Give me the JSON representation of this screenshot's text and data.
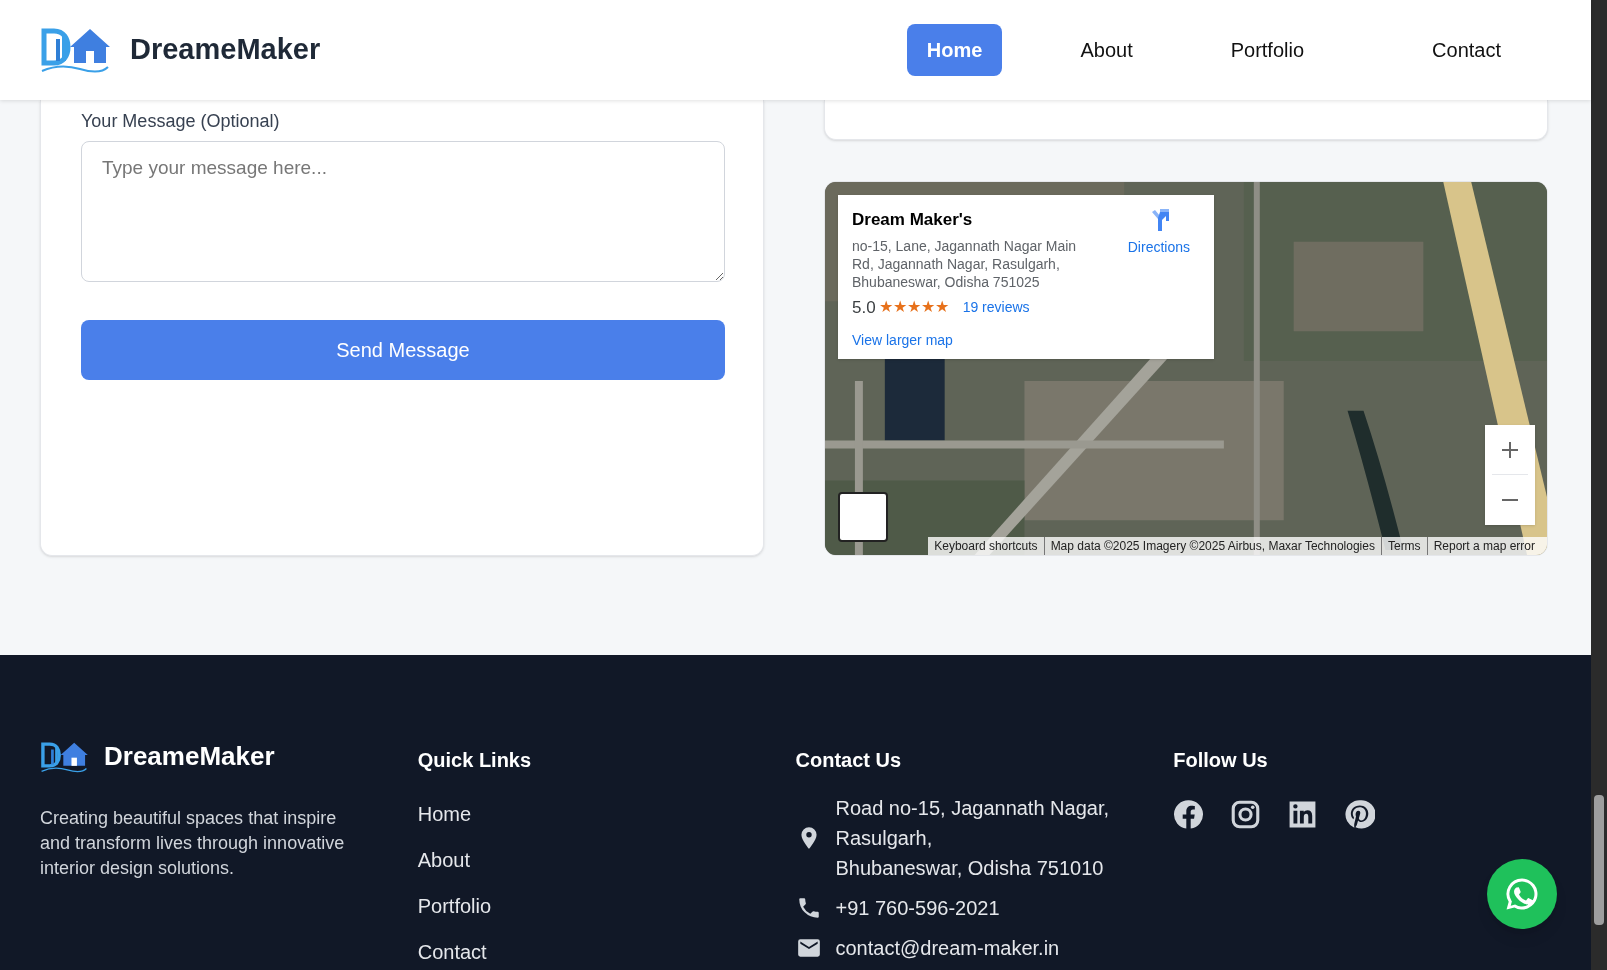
{
  "header": {
    "brand": "DreameMaker",
    "nav": [
      {
        "label": "Home",
        "selected": true
      },
      {
        "label": "About",
        "selected": false
      },
      {
        "label": "Portfolio",
        "selected": false
      },
      {
        "label": "Contact",
        "selected": false
      }
    ]
  },
  "form": {
    "message_label": "Your Message (Optional)",
    "message_placeholder": "Type your message here...",
    "submit": "Send Message"
  },
  "map": {
    "place_name": "Dream Maker's",
    "address": "no-15, Lane, Jagannath Nagar Main Rd, Jagannath Nagar, Rasulgarh, Bhubaneswar, Odisha 751025",
    "rating": "5.0",
    "stars": 5,
    "reviews": "19 reviews",
    "view_larger": "View larger map",
    "directions": "Directions",
    "attribution": [
      "Keyboard shortcuts",
      "Map data ©2025 Imagery ©2025 Airbus, Maxar Technologies",
      "Terms",
      "Report a map error"
    ]
  },
  "footer": {
    "brand": "DreameMaker",
    "description": "Creating beautiful spaces that inspire and transform lives through innovative interior design solutions.",
    "quick_links": {
      "title": "Quick Links",
      "links": [
        "Home",
        "About",
        "Portfolio",
        "Contact"
      ]
    },
    "contact": {
      "title": "Contact Us",
      "items": [
        {
          "kind": "address",
          "lines": [
            "Road no-15, Jagannath Nagar,",
            "Rasulgarh,",
            "Bhubaneswar, Odisha 751010"
          ]
        },
        {
          "kind": "phone",
          "lines": [
            "+91 760-596-2021"
          ]
        },
        {
          "kind": "email",
          "lines": [
            "contact@dream-maker.in"
          ]
        }
      ]
    },
    "follow": {
      "title": "Follow Us"
    }
  }
}
